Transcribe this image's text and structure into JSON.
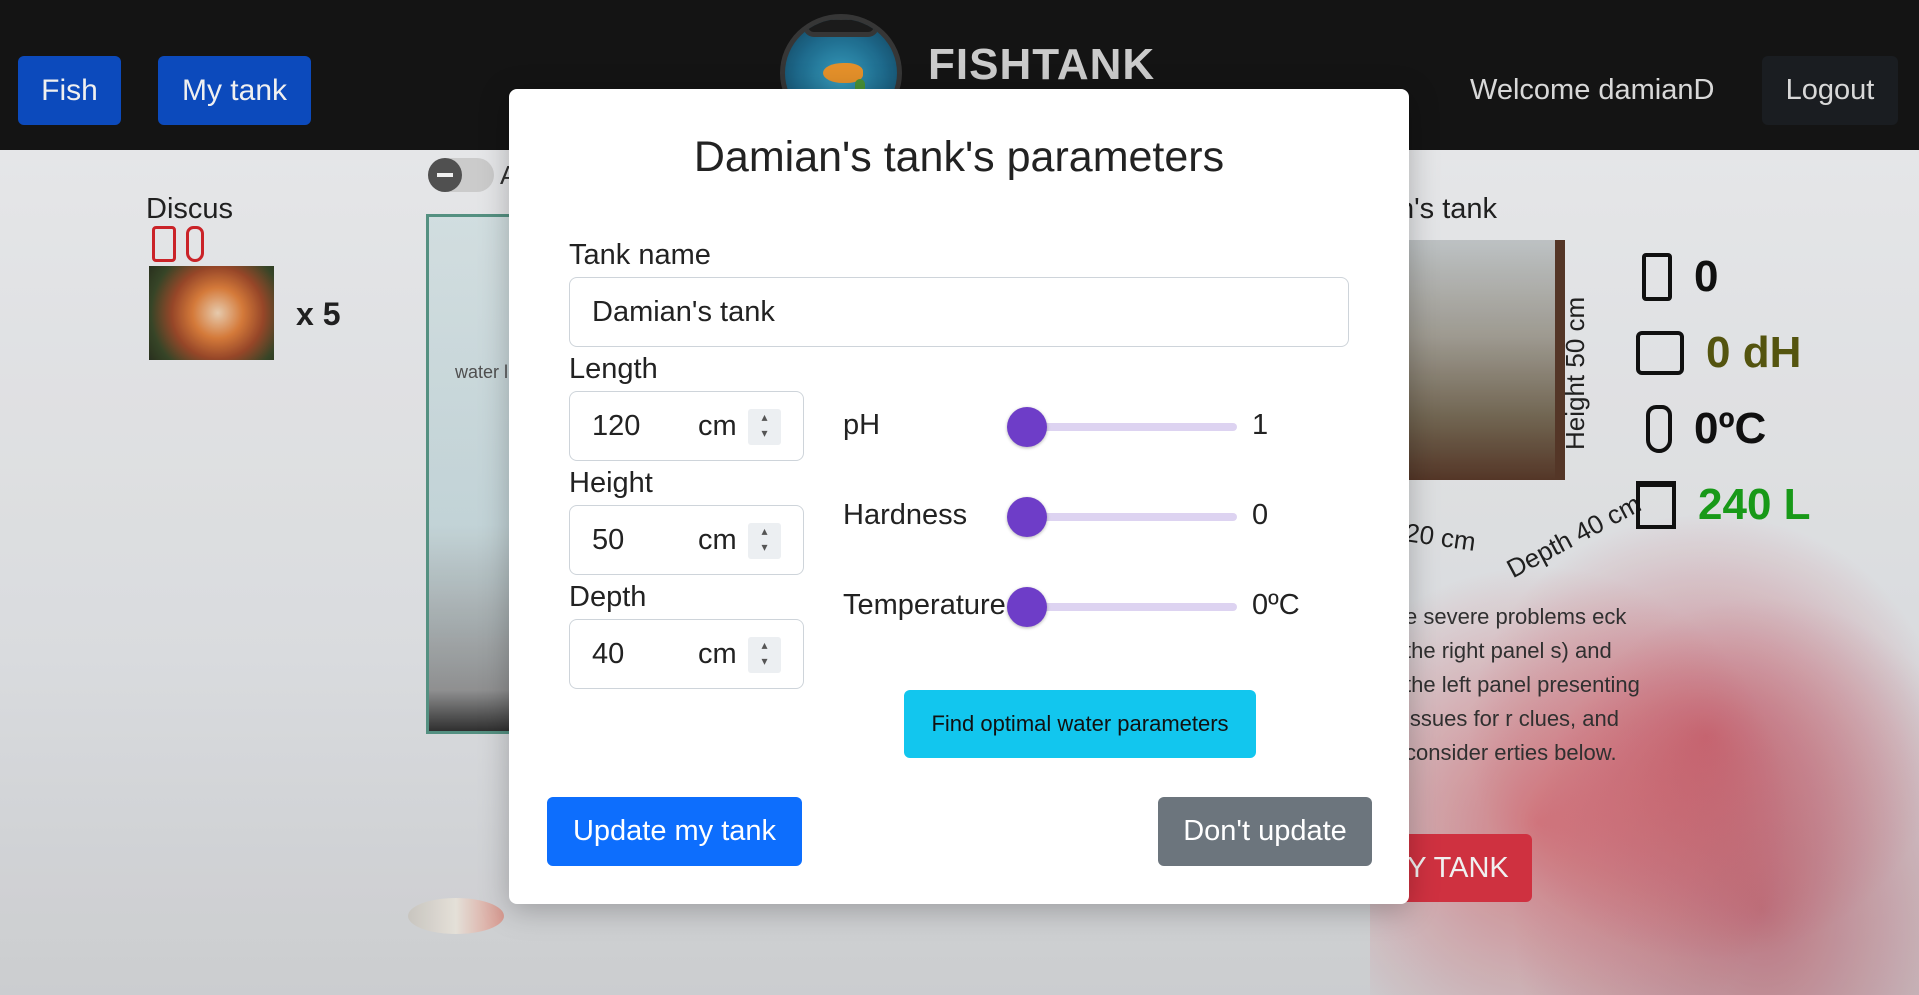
{
  "navbar": {
    "fish_label": "Fish",
    "mytank_label": "My tank",
    "brand": "FISHTANK",
    "welcome": "Welcome damianD",
    "logout_label": "Logout"
  },
  "background": {
    "fish_species": "Discus",
    "fish_count": "x 5",
    "toggle_label": "A",
    "water_label": "water l",
    "tank_title_fragment": "n's tank",
    "dim_height": "Height 50 cm",
    "dim_length": "20 cm",
    "dim_depth": "Depth 40 cm",
    "stats": {
      "ph": "0",
      "hardness": "0 dH",
      "temperature": "0ºC",
      "volume": "240 L"
    },
    "stat_colors": {
      "hardness": "#5a5a10",
      "volume": "#1aa31a"
    },
    "info_text_fragment": "e severe problems eck the right panel s) and the left panel presenting issues for r clues, and consider erties below.",
    "red_button_fragment": "Y TANK"
  },
  "modal": {
    "title": "Damian's tank's parameters",
    "tank_name_label": "Tank name",
    "tank_name_value": "Damian's tank",
    "length": {
      "label": "Length",
      "value": "120",
      "unit": "cm"
    },
    "height": {
      "label": "Height",
      "value": "50",
      "unit": "cm"
    },
    "depth": {
      "label": "Depth",
      "value": "40",
      "unit": "cm"
    },
    "sliders": {
      "ph": {
        "label": "pH",
        "value": "1",
        "fraction": 0.0
      },
      "hardness": {
        "label": "Hardness",
        "value": "0",
        "fraction": 0.0
      },
      "temperature": {
        "label": "Temperature",
        "value": "0ºC",
        "fraction": 0.0
      }
    },
    "optimal_button": "Find optimal water parameters",
    "update_button": "Update my tank",
    "dont_update_button": "Don't update"
  },
  "colors": {
    "primary": "#0d6efd",
    "slider_accent": "#6e3dc8",
    "info": "#12c6ee",
    "secondary": "#6c757d",
    "danger": "#dc3545"
  }
}
